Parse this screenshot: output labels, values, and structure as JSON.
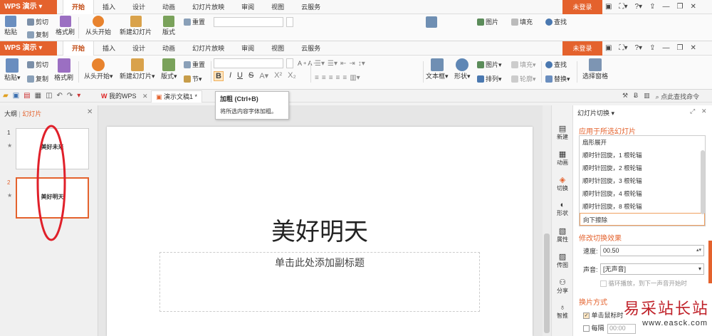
{
  "app_name": "WPS 演示",
  "menu_tabs": [
    "开始",
    "插入",
    "设计",
    "动画",
    "幻灯片放映",
    "审阅",
    "视图",
    "云服务"
  ],
  "login_label": "未登录",
  "ribbon": {
    "paste": "粘贴",
    "cut": "剪切",
    "copy": "复制",
    "format_brush": "格式刷",
    "from_start": "从头开始",
    "new_slide": "新建幻灯片",
    "layout": "版式",
    "reset": "重置",
    "section": "节",
    "textbox": "文本框",
    "shape": "形状",
    "picture": "图片",
    "fill": "填充",
    "arrange": "排列",
    "outline": "轮廓",
    "find": "查找",
    "replace": "替换",
    "select_pane": "选择窗格",
    "bold": "B",
    "italic": "I",
    "underline": "U",
    "strike": "S"
  },
  "quick_bar": {
    "doc_tab_1": "我的WPS",
    "doc_tab_2": "演示文稿1 *",
    "search_cmd": "点此查找命令"
  },
  "tooltip": {
    "title": "加粗 (Ctrl+B)",
    "desc": "将所选内容字体加粗。"
  },
  "left_pane": {
    "tab_outline": "大纲",
    "tab_slides": "幻灯片",
    "slides": [
      {
        "num": "1",
        "text": "美好未来"
      },
      {
        "num": "2",
        "text": "美好明天"
      }
    ]
  },
  "slide": {
    "title": "美好明天",
    "subtitle_placeholder": "单击此处添加副标题"
  },
  "side_icons": [
    "新建",
    "动画",
    "切换",
    "形状",
    "属性",
    "传图",
    "分享",
    "智推"
  ],
  "right_panel": {
    "header": "幻灯片切换",
    "section_apply": "应用于所选幻灯片",
    "transitions": [
      "扇形展开",
      "顺时针回旋，1 根轮辐",
      "顺时针回旋，2 根轮辐",
      "顺时针回旋，3 根轮辐",
      "顺时针回旋，4 根轮辐",
      "顺时针回旋，8 根轮辐",
      "向下擦除"
    ],
    "section_modify": "修改切换效果",
    "speed_label": "速度:",
    "speed_value": "00.50",
    "sound_label": "声音:",
    "sound_value": "[无声音]",
    "loop_label": "循环播放，到下一声音开始时",
    "section_mode": "换片方式",
    "on_click_label": "单击鼠标时",
    "every_label": "每隔",
    "every_value": "00:00"
  },
  "watermark": {
    "cn": "易采站长站",
    "url": "www.easck.com"
  },
  "colors": {
    "accent": "#e4622d",
    "annotation": "#e0202a"
  }
}
